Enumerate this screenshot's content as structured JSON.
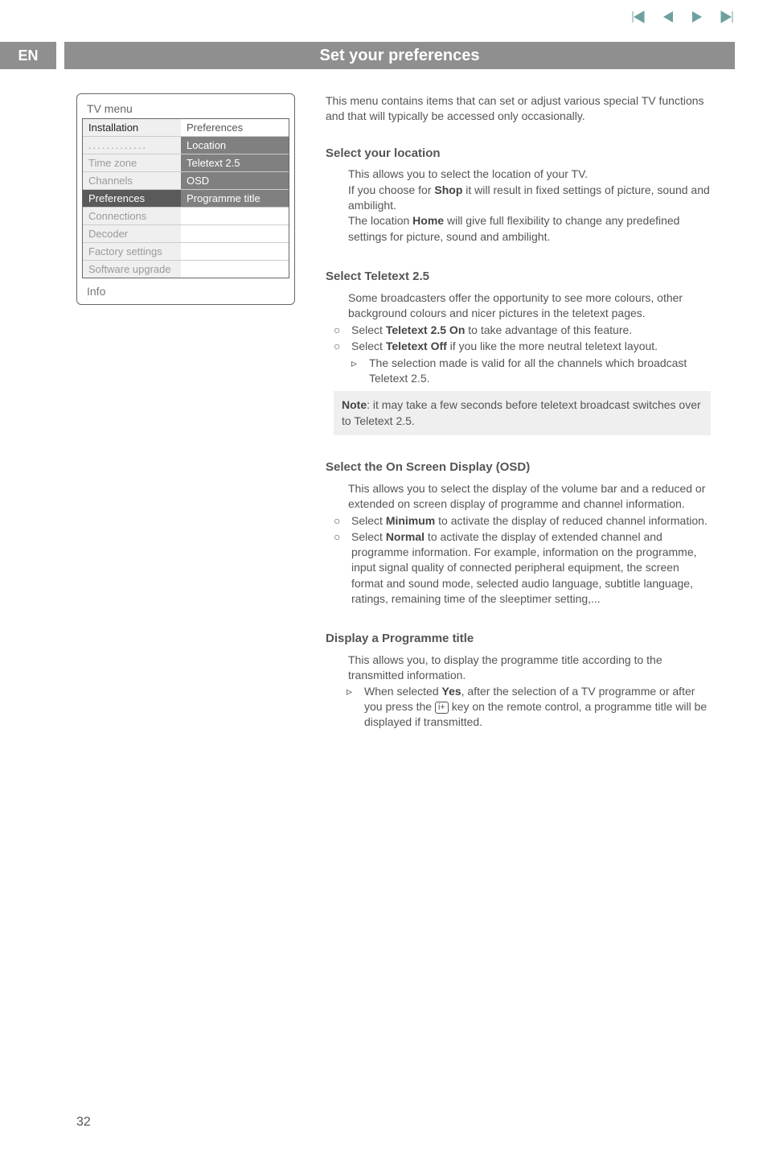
{
  "header": {
    "lang_badge": "EN",
    "title": "Set your preferences"
  },
  "nav_icons": {
    "first": "first-icon",
    "prev": "prev-icon",
    "next": "next-icon",
    "last": "last-icon"
  },
  "menu": {
    "title": "TV menu",
    "col2_header": "Preferences",
    "rows": [
      {
        "left": "Installation",
        "right": "Preferences",
        "ltype": "hl",
        "rtype": "hdr"
      },
      {
        "left": ".............",
        "right": "Location",
        "ltype": "row2",
        "rtype": "dk"
      },
      {
        "left": "Time zone",
        "right": "Teletext 2.5",
        "ltype": "row2",
        "rtype": "dk"
      },
      {
        "left": "Channels",
        "right": "OSD",
        "ltype": "row2",
        "rtype": "dk"
      },
      {
        "left": "Preferences",
        "right": "Programme title",
        "ltype": "sel",
        "rtype": "dk"
      },
      {
        "left": "Connections",
        "right": "",
        "ltype": "row2",
        "rtype": ""
      },
      {
        "left": "Decoder",
        "right": "",
        "ltype": "row2",
        "rtype": ""
      },
      {
        "left": "Factory settings",
        "right": "",
        "ltype": "row2",
        "rtype": ""
      },
      {
        "left": "Software upgrade",
        "right": "",
        "ltype": "row2",
        "rtype": ""
      }
    ],
    "info": "Info"
  },
  "intro": "This menu contains items that can set or adjust various special TV functions and that will typically be accessed only occasionally.",
  "sections": {
    "location": {
      "h": "Select your location",
      "p1a": "This allows you to select the location of your TV.",
      "p1b_a": "If you choose for ",
      "p1b_bold": "Shop",
      "p1b_c": " it will result in fixed settings of picture, sound and ambilight.",
      "p1c_a": "The location ",
      "p1c_bold": "Home",
      "p1c_c": " will give full flexibility to change any predefined settings for picture, sound and ambilight."
    },
    "teletext": {
      "h": "Select Teletext 2.5",
      "p1": "Some broadcasters offer the opportunity to see more colours, other background colours and nicer pictures in the teletext pages.",
      "b1_a": "Select ",
      "b1_bold": "Teletext 2.5 On",
      "b1_c": " to take advantage of this feature.",
      "b2_a": "Select ",
      "b2_bold": "Teletext Off",
      "b2_c": " if you like the more neutral teletext layout.",
      "sub_a": "The selection made is valid for all the channels which broadcast Teletext 2.5.",
      "note_bold": "Note",
      "note_text": ": it may take a few seconds before teletext broadcast switches over to Teletext 2.5."
    },
    "osd": {
      "h": "Select the On Screen Display (OSD)",
      "p1": "This allows you to select the display of the volume bar and a reduced or extended on screen display of programme and channel information.",
      "b1_a": "Select ",
      "b1_bold": "Minimum",
      "b1_c": " to activate the display of reduced channel information.",
      "b2_a": "Select ",
      "b2_bold": "Normal",
      "b2_c": " to activate the display of extended channel and programme information. For example, information on the programme, input signal quality of connected peripheral equipment, the screen format and sound mode, selected audio language, subtitle language, ratings, remaining time of the sleeptimer setting,..."
    },
    "progtitle": {
      "h": "Display a Programme title",
      "p1": "This allows you, to display the programme title according to the transmitted information.",
      "sub_a": "When selected ",
      "sub_bold": "Yes",
      "sub_b": ", after the selection of a TV programme or after you press the ",
      "sub_c": " key on the remote control, a  programme title will be displayed if transmitted."
    }
  },
  "iplus_label": "i+",
  "page_number": "32"
}
